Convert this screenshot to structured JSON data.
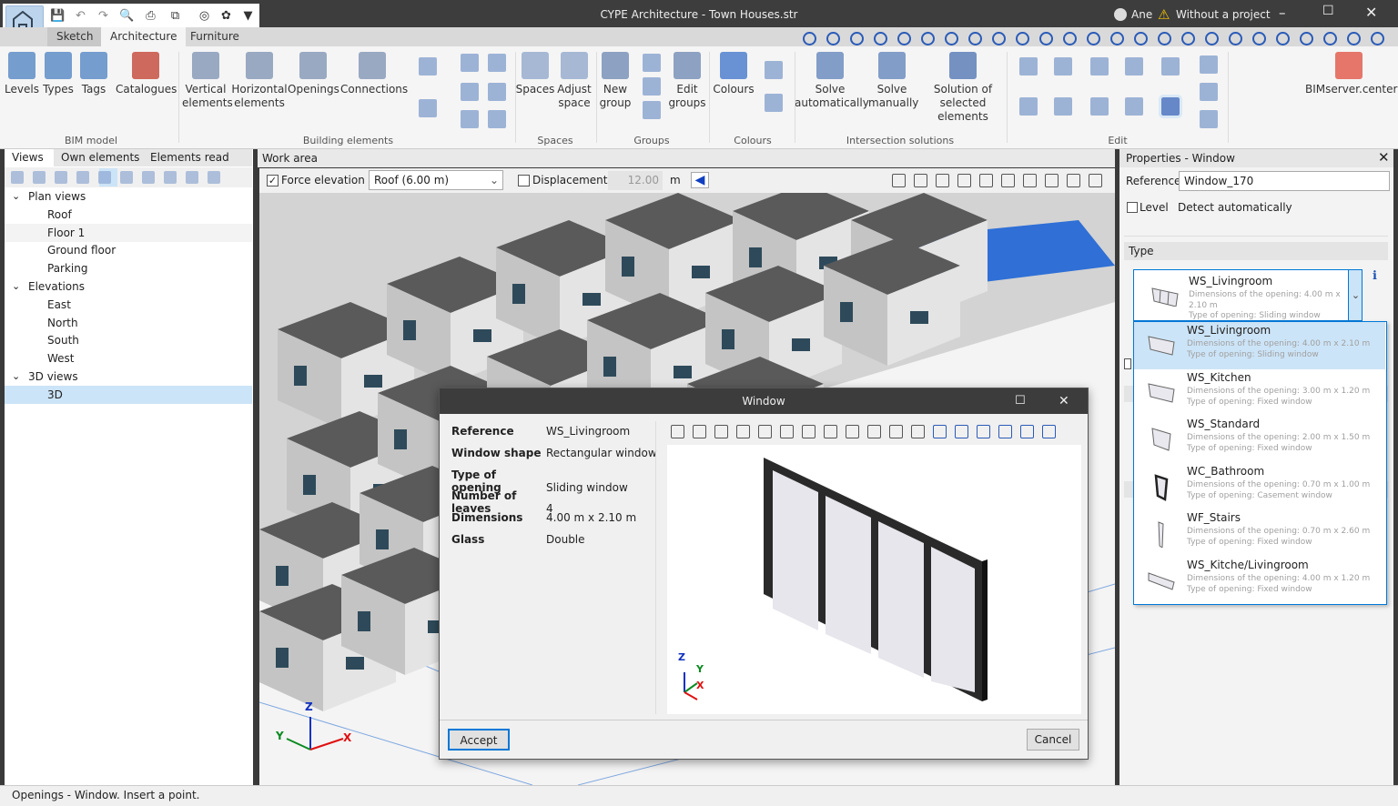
{
  "app": {
    "title": "CYPE Architecture - Town Houses.str",
    "user": "Ane",
    "project_status": "Without a project"
  },
  "ribbon": {
    "tabs": [
      "Sketch",
      "Architecture",
      "Furniture"
    ],
    "active_tab": "Architecture",
    "buttons": [
      {
        "label": "Levels",
        "icon": "levels-icon"
      },
      {
        "label": "Types",
        "icon": "types-icon"
      },
      {
        "label": "Tags",
        "icon": "tags-icon"
      },
      {
        "label": "Catalogues",
        "icon": "catalogues-icon"
      },
      {
        "label": "Vertical elements",
        "icon": "vertical-elements-icon"
      },
      {
        "label": "Horizontal elements",
        "icon": "horizontal-elements-icon"
      },
      {
        "label": "Openings",
        "icon": "openings-icon"
      },
      {
        "label": "Connections",
        "icon": "connections-icon"
      },
      {
        "label": "Spaces",
        "icon": "spaces-icon"
      },
      {
        "label": "Adjust space",
        "icon": "adjust-space-icon"
      },
      {
        "label": "New group",
        "icon": "new-group-icon"
      },
      {
        "label": "Edit groups",
        "icon": "edit-groups-icon"
      },
      {
        "label": "Colours",
        "icon": "colours-icon"
      },
      {
        "label": "Solve automatically",
        "icon": "solve-automatically-icon"
      },
      {
        "label": "Solve manually",
        "icon": "solve-manually-icon"
      },
      {
        "label": "Solution of selected elements",
        "icon": "solution-selected-icon"
      },
      {
        "label": "BIMserver.center",
        "icon": "bimserver-icon"
      }
    ],
    "groups": [
      "BIM model",
      "Building elements",
      "Spaces",
      "Groups",
      "Colours",
      "Intersection solutions",
      "Edit"
    ]
  },
  "left_panel": {
    "tabs": [
      "Views",
      "Own elements",
      "Elements read"
    ],
    "tree": [
      {
        "label": "Plan views",
        "level": 0,
        "expanded": true
      },
      {
        "label": "Roof",
        "level": 1
      },
      {
        "label": "Floor 1",
        "level": 1
      },
      {
        "label": "Ground floor",
        "level": 1
      },
      {
        "label": "Parking",
        "level": 1
      },
      {
        "label": "Elevations",
        "level": 0,
        "expanded": true
      },
      {
        "label": "East",
        "level": 1
      },
      {
        "label": "North",
        "level": 1
      },
      {
        "label": "South",
        "level": 1
      },
      {
        "label": "West",
        "level": 1
      },
      {
        "label": "3D views",
        "level": 0,
        "expanded": true
      },
      {
        "label": "3D",
        "level": 1,
        "selected": true
      }
    ]
  },
  "work_area": {
    "label": "Work area",
    "force_elevation_label": "Force elevation",
    "force_elevation_checked": true,
    "level_select": "Roof (6.00 m)",
    "displacement_label": "Displacement",
    "displacement_checked": false,
    "displacement_value": "12.00",
    "displacement_unit": "m",
    "axes": {
      "x": "X",
      "y": "Y",
      "z": "Z"
    }
  },
  "properties": {
    "title": "Properties - Window",
    "reference_label": "Reference",
    "reference_value": "Window_170",
    "level_label": "Level",
    "level_checked": false,
    "level_value": "Detect automatically",
    "type_section": "Type",
    "selected_type": {
      "name": "WS_Livingroom",
      "dim": "Dimensions of the opening: 4.00 m x 2.10 m",
      "kind": "Type of opening: Sliding window"
    },
    "type_options": [
      {
        "name": "WS_Livingroom",
        "dim": "Dimensions of the opening: 4.00 m x 2.10 m",
        "kind": "Type of opening: Sliding window"
      },
      {
        "name": "WS_Kitchen",
        "dim": "Dimensions of the opening: 3.00 m x 1.20 m",
        "kind": "Type of opening: Fixed window"
      },
      {
        "name": "WS_Standard",
        "dim": "Dimensions of the opening: 2.00 m x 1.50 m",
        "kind": "Type of opening: Fixed window"
      },
      {
        "name": "WC_Bathroom",
        "dim": "Dimensions of the opening: 0.70 m x 1.00 m",
        "kind": "Type of opening: Casement window"
      },
      {
        "name": "WF_Stairs",
        "dim": "Dimensions of the opening: 0.70 m x 2.60 m",
        "kind": "Type of opening: Fixed window"
      },
      {
        "name": "WS_Kitche/Livingroom",
        "dim": "Dimensions of the opening: 4.00 m x 1.20 m",
        "kind": "Type of opening: Fixed window"
      }
    ]
  },
  "dialog": {
    "title": "Window",
    "props": [
      {
        "label": "Reference",
        "value": "WS_Livingroom"
      },
      {
        "label": "Window shape",
        "value": "Rectangular window"
      },
      {
        "label": "Type of opening",
        "value": "Sliding window"
      },
      {
        "label": "Number of leaves",
        "value": "4"
      },
      {
        "label": "Dimensions",
        "value": "4.00 m x 2.10 m"
      },
      {
        "label": "Glass",
        "value": "Double"
      }
    ],
    "accept": "Accept",
    "cancel": "Cancel"
  },
  "status": "Openings - Window. Insert a point.",
  "colors": {
    "accent": "#0078d7",
    "selection": "#cce4f7",
    "titlebar": "#3d3d3d"
  }
}
